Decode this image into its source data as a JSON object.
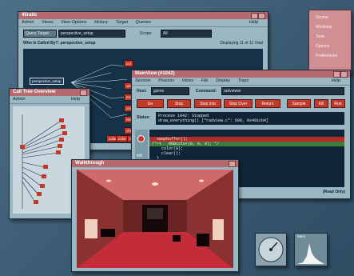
{
  "widget_panel": {
    "items": [
      "Source",
      "Windows",
      "Tools",
      "Options",
      "Preferences"
    ]
  },
  "cvd_main": {
    "title": "45ratic",
    "menu": [
      "Admin",
      "Views",
      "View Options",
      "History",
      "Target",
      "Queries"
    ],
    "help": "Help",
    "query_label": "Query Target:",
    "query_value": "perspective_setup",
    "scope_label": "Scope:",
    "scope_value": "All",
    "who_label": "Who Is Called By?: perspective_setup",
    "display_count": "Displaying 11 of 11 Total",
    "root_node": "perspective_setup",
    "side_nodes": [
      "col",
      "viewcolor",
      "mcolor",
      "cmov",
      "rmov",
      "chavr"
    ],
    "bottom_nodes": [
      "color",
      "color",
      "color"
    ]
  },
  "call_tree": {
    "title": "Call Tree Overview",
    "menu": [
      "Admin"
    ],
    "help": "Help"
  },
  "main_view": {
    "title": "MainView (#1042)",
    "menu": [
      "Session",
      "Process",
      "Views",
      "File",
      "Display",
      "Traps"
    ],
    "help": "Help",
    "host_label": "Host:",
    "host_value": "gizmo",
    "command_label": "Command:",
    "command_value": "radviewer",
    "buttons": [
      "Go",
      "Stop",
      "Step Into",
      "Step Over",
      "Return",
      "Sample",
      "Kill",
      "Run"
    ],
    "status_label": "Status:",
    "status_lines": [
      "Process 1042: Stopped",
      "draw_everything() [\"radview.c\": 680, 0x401cb4]"
    ],
    "code_lines": [
      "  swapbuffer();",
      "/*rt   RGBcolor(0, 0, 0); */",
      "    color(0);",
      "    clear();",
      "  }"
    ],
    "read_only": "(Read Only)"
  },
  "walkthrough": {
    "title": "Walkthrough"
  },
  "gauges": {
    "speed_label": "",
    "load_label": "Mem"
  }
}
